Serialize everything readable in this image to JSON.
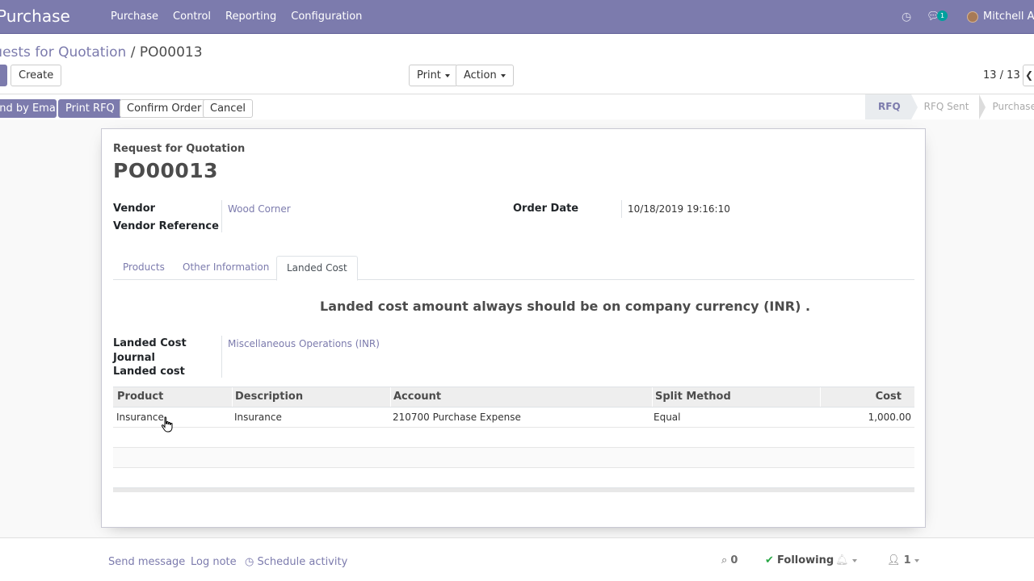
{
  "navbar": {
    "app_name": "Purchase",
    "menu": [
      "Purchase",
      "Control",
      "Reporting",
      "Configuration"
    ],
    "messages_count": "1",
    "user_name": "Mitchell Admin"
  },
  "control_panel": {
    "breadcrumb_parent": "Requests for Quotation",
    "breadcrumb_sep": " / ",
    "breadcrumb_current": "PO00013",
    "create_label": "Create",
    "print_label": "Print",
    "action_label": "Action",
    "pager": "13 / 13"
  },
  "statusbar": {
    "buttons": [
      "Send by Email",
      "Print RFQ",
      "Confirm Order",
      "Cancel"
    ],
    "stages": [
      "RFQ",
      "RFQ Sent",
      "Purchase Order"
    ],
    "active_stage": "RFQ"
  },
  "sheet": {
    "subtitle": "Request for Quotation",
    "title": "PO00013",
    "vendor_label": "Vendor",
    "vendor_value": "Wood Corner",
    "vendor_ref_label": "Vendor Reference",
    "order_date_label": "Order Date",
    "order_date_value": "10/18/2019 19:16:10",
    "tabs": [
      "Products",
      "Other Information",
      "Landed Cost"
    ],
    "active_tab": "Landed Cost",
    "notice": "Landed cost amount always should be on company currency (INR) .",
    "journal_label_1": "Landed Cost",
    "journal_label_2": "Journal",
    "journal_value": "Miscellaneous Operations (INR)",
    "landed_cost_label": "Landed cost",
    "table": {
      "headers": [
        "Product",
        "Description",
        "Account",
        "Split Method",
        "Cost"
      ],
      "rows": [
        [
          "Insurance",
          "Insurance",
          "210700 Purchase Expense",
          "Equal",
          "1,000.00"
        ]
      ]
    }
  },
  "chatter": {
    "send_message": "Send message",
    "log_note": "Log note",
    "schedule_activity": "Schedule activity",
    "attachments_count": "0",
    "following": "Following",
    "followers_count": "1"
  }
}
